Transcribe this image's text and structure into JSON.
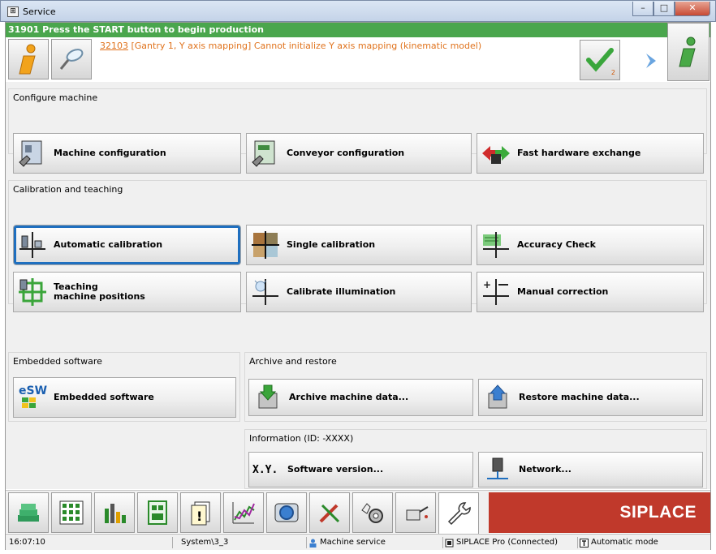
{
  "window": {
    "title": "Service",
    "icon": "app-icon",
    "controls": [
      "minimize-icon",
      "maximize-icon",
      "close-icon"
    ]
  },
  "status_bar_top": "31901 Press the START button to begin production",
  "message": {
    "code": "32103",
    "text": " [Gantry 1, Y axis mapping] Cannot initialize Y axis mapping (kinematic model)",
    "ack_count": "2"
  },
  "groups": {
    "configure": {
      "title": "Configure machine",
      "items": [
        "Machine configuration",
        "Conveyor configuration",
        "Fast hardware exchange"
      ]
    },
    "calibration": {
      "title": "Calibration and teaching",
      "items": [
        "Automatic calibration",
        "Single calibration",
        "Accuracy Check",
        "Teaching machine positions",
        "Calibrate illumination",
        "Manual correction"
      ],
      "teaching_line1": "Teaching",
      "teaching_line2": "machine positions"
    },
    "embedded": {
      "title": "Embedded software",
      "items": [
        "Embedded software"
      ]
    },
    "archive": {
      "title": "Archive and restore",
      "items": [
        "Archive machine data...",
        "Restore machine data..."
      ]
    },
    "information": {
      "title": "Information (ID: -XXXX)",
      "items": [
        "Software version...",
        "Network..."
      ],
      "software_icon_text": "X.Y."
    }
  },
  "nav": {
    "buttons": [
      "setup-icon",
      "component-grid-icon",
      "bar-chart-icon",
      "board-icon",
      "warning-doc-icon",
      "trend-chart-icon",
      "camera-icon",
      "tools-icon",
      "gears-hand-icon",
      "oil-can-icon",
      "wrench-icon"
    ],
    "active": "wrench-icon",
    "brand": "SIPLACE"
  },
  "statusbar": {
    "time": "16:07:10",
    "station": "System\\3_3",
    "user": "Machine service",
    "connection": "SIPLACE Pro (Connected)",
    "mode": "Automatic mode"
  },
  "colors": {
    "status_green": "#4aa64d",
    "message_orange": "#e0731d",
    "brand_red": "#c0392b",
    "focus_blue": "#1f6fbf"
  }
}
